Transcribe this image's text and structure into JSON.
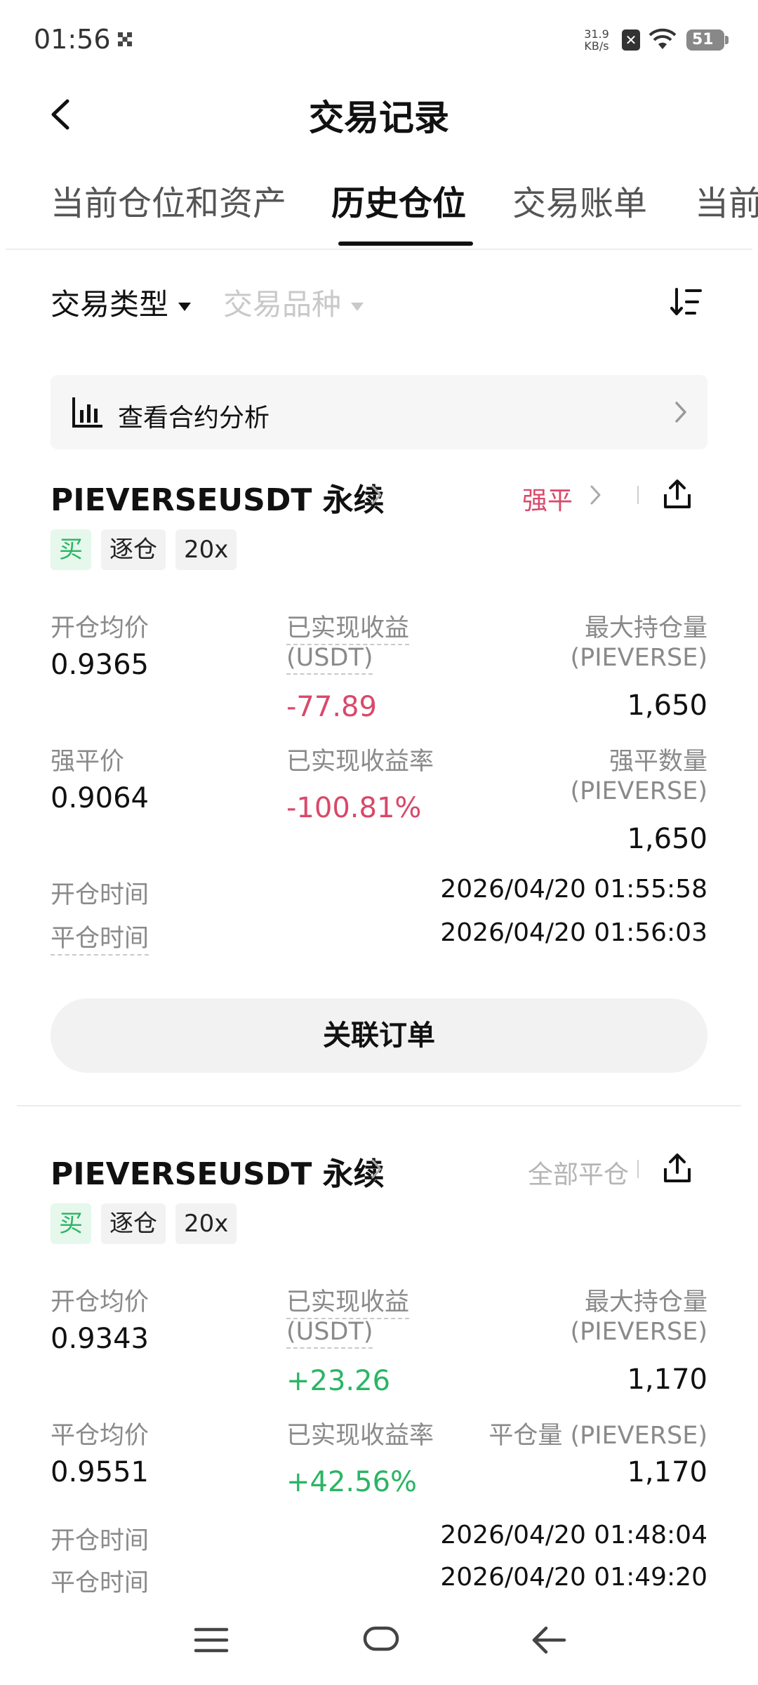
{
  "status_bar": {
    "time": "01:56",
    "net_speed_value": "31.9",
    "net_speed_unit": "KB/s",
    "sim_icon_glyph": "✕",
    "battery_level": "51"
  },
  "header": {
    "title": "交易记录"
  },
  "tabs": [
    {
      "label": "当前仓位和资产"
    },
    {
      "label": "历史仓位"
    },
    {
      "label": "交易账单"
    },
    {
      "label": "当前"
    }
  ],
  "filters": {
    "trade_type": "交易类型",
    "trade_symbol": "交易品种"
  },
  "analysis_link": {
    "label": "查看合约分析"
  },
  "positions": [
    {
      "title": "PIEVERSEUSDT 永续",
      "status": "强平",
      "tags": [
        "买",
        "逐仓",
        "20x"
      ],
      "open_price_label": "开仓均价",
      "open_price": "0.9365",
      "pnl_label_1": "已实现收益",
      "pnl_label_2": "(USDT)",
      "pnl": "-77.89",
      "max_pos_label_1": "最大持仓量",
      "max_pos_label_2": "(PIEVERSE)",
      "max_pos": "1,650",
      "price2_label": "强平价",
      "price2": "0.9064",
      "pnl_rate_label": "已实现收益率",
      "pnl_rate": "-100.81%",
      "qty2_label_1": "强平数量",
      "qty2_label_2": "(PIEVERSE)",
      "qty2": "1,650",
      "open_time_label": "开仓时间",
      "open_time": "2026/04/20 01:55:58",
      "close_time_label": "平仓时间",
      "close_time": "2026/04/20 01:56:03",
      "button_label": "关联订单"
    },
    {
      "title": "PIEVERSEUSDT 永续",
      "status": "全部平仓",
      "tags": [
        "买",
        "逐仓",
        "20x"
      ],
      "open_price_label": "开仓均价",
      "open_price": "0.9343",
      "pnl_label_1": "已实现收益",
      "pnl_label_2": "(USDT)",
      "pnl": "+23.26",
      "max_pos_label_1": "最大持仓量",
      "max_pos_label_2": "(PIEVERSE)",
      "max_pos": "1,170",
      "price2_label": "平仓均价",
      "price2": "0.9551",
      "pnl_rate_label": "已实现收益率",
      "pnl_rate": "+42.56%",
      "qty2_label_1": "平仓量 (PIEVERSE)",
      "qty2": "1,170",
      "open_time_label": "开仓时间",
      "open_time": "2026/04/20 01:48:04",
      "close_time_label": "平仓时间",
      "close_time": "2026/04/20 01:49:20"
    }
  ],
  "colors": {
    "negative": "#d9486a",
    "positive": "#2bb564",
    "buy_tag_bg": "#e6f7ec",
    "muted_text": "#8a8a8a"
  }
}
